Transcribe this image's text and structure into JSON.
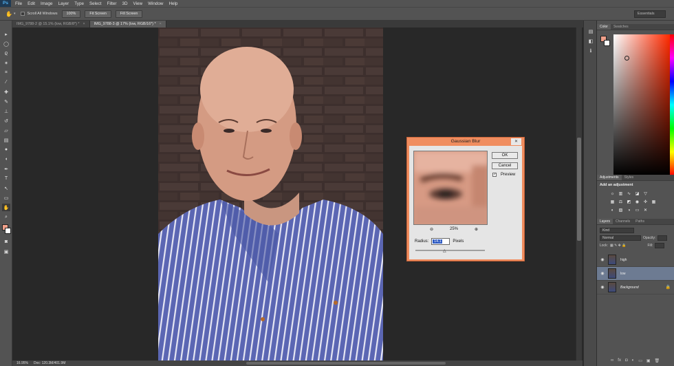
{
  "menubar": {
    "logo": "Ps",
    "items": [
      "File",
      "Edit",
      "Image",
      "Layer",
      "Type",
      "Select",
      "Filter",
      "3D",
      "View",
      "Window",
      "Help"
    ]
  },
  "options": {
    "scroll_all": "Scroll All Windows",
    "btn_100": "100%",
    "btn_fit": "Fit Screen",
    "btn_fill": "Fill Screen",
    "workspace": "Essentials"
  },
  "tabs": [
    {
      "label": "IMG_9788-2 @ 15.1% (low, RGB/8*) *"
    },
    {
      "label": "IMG_9788-3 @ 17% (low, RGB/16*) *"
    }
  ],
  "status": {
    "zoom": "16.95%",
    "doc": "Doc: 120.3M/401.9M"
  },
  "color_panel": {
    "tab_color": "Color",
    "tab_swatches": "Swatches",
    "foreground": "#f0a08a"
  },
  "adjustments": {
    "tab_adjustments": "Adjustments",
    "tab_styles": "Styles",
    "title": "Add an adjustment"
  },
  "layers": {
    "tab_layers": "Layers",
    "tab_channels": "Channels",
    "tab_paths": "Paths",
    "kind": "Kind",
    "blend": "Normal",
    "opacity_label": "Opacity:",
    "lock_label": "Lock:",
    "fill_label": "Fill:",
    "items": [
      {
        "name": "high"
      },
      {
        "name": "low"
      },
      {
        "name": "Background"
      }
    ]
  },
  "dialog": {
    "title": "Gaussian Blur",
    "ok": "OK",
    "cancel": "Cancel",
    "preview": "Preview",
    "zoom": "25%",
    "radius_label": "Radius:",
    "radius_value": "14.1",
    "units": "Pixels"
  }
}
